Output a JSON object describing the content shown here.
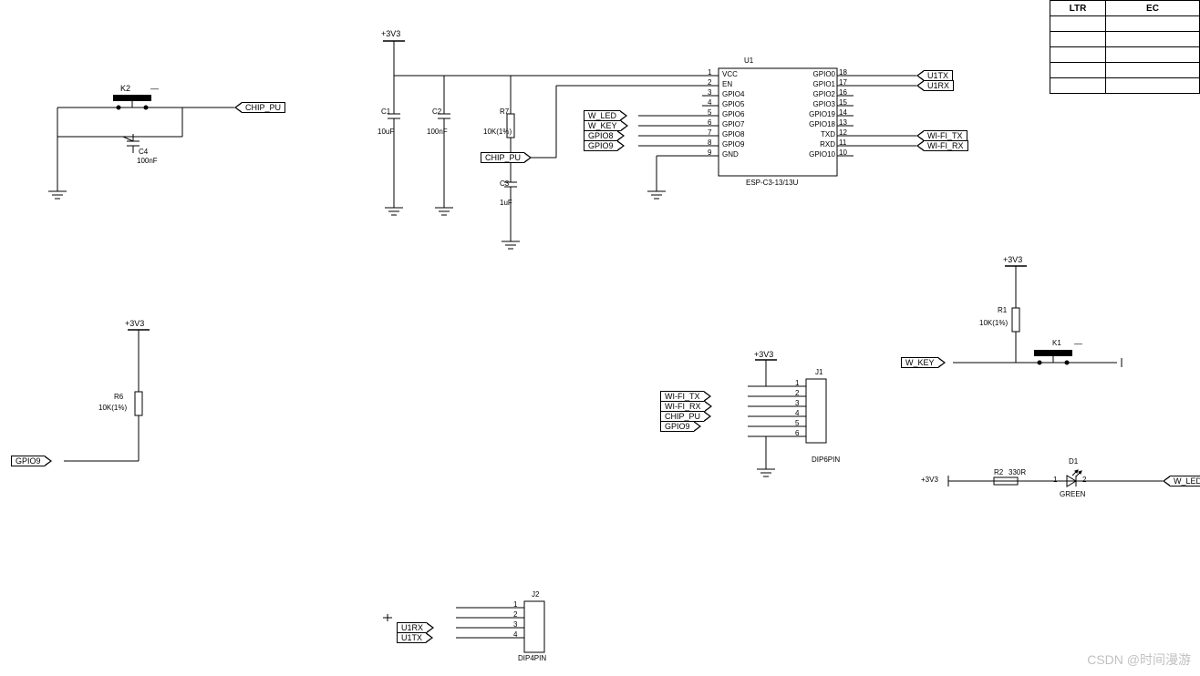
{
  "power": {
    "rail": "+3V3"
  },
  "k2": {
    "refdes": "K2",
    "netlabel": "CHIP_PU"
  },
  "c4": {
    "refdes": "C4",
    "value": "100nF"
  },
  "c1": {
    "refdes": "C1",
    "value": "10uF"
  },
  "c2": {
    "refdes": "C2",
    "value": "100nF"
  },
  "c3": {
    "refdes": "C3",
    "value": "1uF"
  },
  "r7": {
    "refdes": "R7",
    "value": "10K(1%)"
  },
  "r7_net": "CHIP_PU",
  "u1": {
    "refdes": "U1",
    "part": "ESP-C3-13/13U",
    "left": [
      {
        "pin": "1",
        "name": "VCC"
      },
      {
        "pin": "2",
        "name": "EN"
      },
      {
        "pin": "3",
        "name": "GPIO4"
      },
      {
        "pin": "4",
        "name": "GPIO5"
      },
      {
        "pin": "5",
        "name": "GPIO6"
      },
      {
        "pin": "6",
        "name": "GPIO7"
      },
      {
        "pin": "7",
        "name": "GPIO8"
      },
      {
        "pin": "8",
        "name": "GPIO9"
      },
      {
        "pin": "9",
        "name": "GND"
      }
    ],
    "right": [
      {
        "pin": "18",
        "name": "GPIO0"
      },
      {
        "pin": "17",
        "name": "GPIO1"
      },
      {
        "pin": "16",
        "name": "GPIO2"
      },
      {
        "pin": "15",
        "name": "GPIO3"
      },
      {
        "pin": "14",
        "name": "GPIO19"
      },
      {
        "pin": "13",
        "name": "GPIO18"
      },
      {
        "pin": "12",
        "name": "TXD"
      },
      {
        "pin": "11",
        "name": "RXD"
      },
      {
        "pin": "10",
        "name": "GPIO10"
      }
    ],
    "left_nets": [
      "",
      "",
      "",
      "",
      "W_LED",
      "W_KEY",
      "GPIO8",
      "GPIO9",
      ""
    ],
    "right_nets": [
      "U1TX",
      "U1RX",
      "",
      "",
      "",
      "",
      "WI-FI_TX",
      "WI-FI_RX",
      ""
    ]
  },
  "r6_block": {
    "rail": "+3V3",
    "refdes": "R6",
    "value": "10K(1%)",
    "net": "GPIO9"
  },
  "j1": {
    "refdes": "J1",
    "part": "DIP6PIN",
    "rail": "+3V3",
    "pins": [
      "1",
      "2",
      "3",
      "4",
      "5",
      "6"
    ],
    "nets": [
      "",
      "WI-FI_TX",
      "WI-FI_RX",
      "CHIP_PU",
      "GPIO9",
      ""
    ]
  },
  "j2": {
    "refdes": "J2",
    "part": "DIP4PIN",
    "pins": [
      "1",
      "2",
      "3",
      "4"
    ],
    "nets": [
      "",
      "",
      "U1RX",
      "U1TX"
    ]
  },
  "k1_block": {
    "rail": "+3V3",
    "r1": {
      "refdes": "R1",
      "value": "10K(1%)"
    },
    "k1": "K1",
    "net": "W_KEY"
  },
  "led_block": {
    "rail": "+3V3",
    "r2": {
      "refdes": "R2",
      "value": "330R"
    },
    "d1": {
      "refdes": "D1",
      "color": "GREEN",
      "p1": "1",
      "p2": "2"
    },
    "net": "W_LED"
  },
  "revtable": {
    "h1": "LTR",
    "h2": "EC"
  },
  "watermark": "CSDN @时间漫游"
}
